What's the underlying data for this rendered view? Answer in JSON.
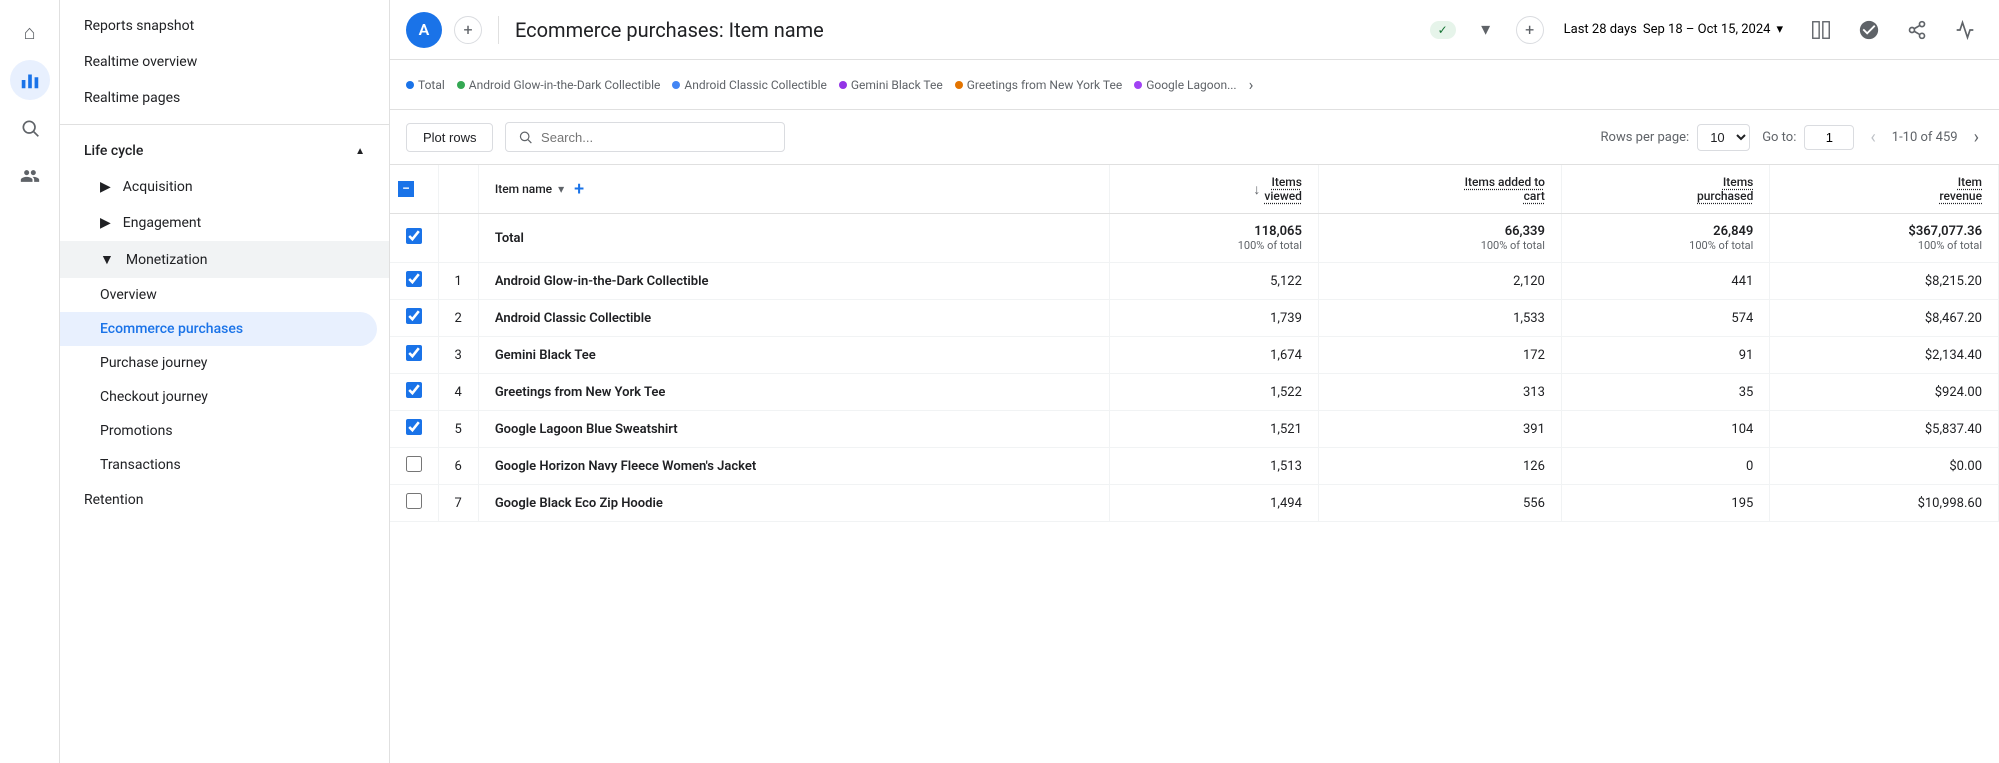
{
  "iconSidebar": {
    "items": [
      {
        "name": "home-icon",
        "icon": "⌂",
        "active": false
      },
      {
        "name": "analytics-icon",
        "icon": "📊",
        "active": true
      },
      {
        "name": "search-icon",
        "icon": "🔍",
        "active": false
      },
      {
        "name": "audience-icon",
        "icon": "👥",
        "active": false
      }
    ]
  },
  "navSidebar": {
    "topItems": [
      {
        "label": "Reports snapshot",
        "active": false
      },
      {
        "label": "Realtime overview",
        "active": false
      },
      {
        "label": "Realtime pages",
        "active": false
      }
    ],
    "sections": [
      {
        "label": "Life cycle",
        "expanded": true,
        "items": [
          {
            "label": "Acquisition",
            "expandable": true,
            "expanded": false,
            "sub": []
          },
          {
            "label": "Engagement",
            "expandable": true,
            "expanded": false,
            "sub": []
          },
          {
            "label": "Monetization",
            "expandable": true,
            "expanded": true,
            "sub": [
              {
                "label": "Overview",
                "active": false
              },
              {
                "label": "Ecommerce purchases",
                "active": true
              },
              {
                "label": "Purchase journey",
                "active": false
              },
              {
                "label": "Checkout journey",
                "active": false
              },
              {
                "label": "Promotions",
                "active": false
              },
              {
                "label": "Transactions",
                "active": false
              }
            ]
          },
          {
            "label": "Retention",
            "expandable": false,
            "expanded": false,
            "sub": []
          }
        ]
      }
    ]
  },
  "header": {
    "avatar": "A",
    "reportTitle": "Ecommerce purchases: Item name",
    "statusLabel": "✓",
    "dateRange": "Sep 18 – Oct 15, 2024",
    "dateLabel": "Last 28 days"
  },
  "chartLegend": {
    "items": [
      {
        "label": "Total",
        "color": "#1a73e8"
      },
      {
        "label": "Android Glow-in-the-Dark Collectible",
        "color": "#34a853"
      },
      {
        "label": "Android Classic Collectible",
        "color": "#4285f4"
      },
      {
        "label": "Gemini Black Tee",
        "color": "#9334e6"
      },
      {
        "label": "Greetings from New York Tee",
        "color": "#e37400"
      },
      {
        "label": "Google Lagoon...",
        "color": "#a142f4"
      }
    ]
  },
  "toolbar": {
    "plotRowsLabel": "Plot rows",
    "searchPlaceholder": "Search...",
    "rowsPerPageLabel": "Rows per page:",
    "rowsPerPageValue": "10",
    "gotoLabel": "Go to:",
    "gotoValue": "1",
    "pageInfo": "1-10 of 459"
  },
  "table": {
    "columns": [
      {
        "label": "",
        "key": "checkbox"
      },
      {
        "label": "",
        "key": "num"
      },
      {
        "label": "Item name",
        "key": "name",
        "hasDropdown": true,
        "hasAdd": true
      },
      {
        "label": "Items\nviewed",
        "key": "viewed",
        "underline": true,
        "hasSortArrow": true
      },
      {
        "label": "Items added to\ncart",
        "key": "cart",
        "underline": true
      },
      {
        "label": "Items\npurchased",
        "key": "purchased",
        "underline": true
      },
      {
        "label": "Item\nrevenue",
        "key": "revenue",
        "underline": true
      }
    ],
    "totalRow": {
      "label": "Total",
      "viewed": "118,065",
      "viewedSub": "100% of total",
      "cart": "66,339",
      "cartSub": "100% of total",
      "purchased": "26,849",
      "purchasedSub": "100% of total",
      "revenue": "$367,077.36",
      "revenueSub": "100% of total"
    },
    "rows": [
      {
        "num": 1,
        "name": "Android Glow-in-the-Dark Collectible",
        "viewed": "5,122",
        "cart": "2,120",
        "purchased": "441",
        "revenue": "$8,215.20",
        "checked": true
      },
      {
        "num": 2,
        "name": "Android Classic Collectible",
        "viewed": "1,739",
        "cart": "1,533",
        "purchased": "574",
        "revenue": "$8,467.20",
        "checked": true
      },
      {
        "num": 3,
        "name": "Gemini Black Tee",
        "viewed": "1,674",
        "cart": "172",
        "purchased": "91",
        "revenue": "$2,134.40",
        "checked": true
      },
      {
        "num": 4,
        "name": "Greetings from New York Tee",
        "viewed": "1,522",
        "cart": "313",
        "purchased": "35",
        "revenue": "$924.00",
        "checked": true
      },
      {
        "num": 5,
        "name": "Google Lagoon Blue Sweatshirt",
        "viewed": "1,521",
        "cart": "391",
        "purchased": "104",
        "revenue": "$5,837.40",
        "checked": true
      },
      {
        "num": 6,
        "name": "Google Horizon Navy Fleece Women's Jacket",
        "viewed": "1,513",
        "cart": "126",
        "purchased": "0",
        "revenue": "$0.00",
        "checked": false
      },
      {
        "num": 7,
        "name": "Google Black Eco Zip Hoodie",
        "viewed": "1,494",
        "cart": "556",
        "purchased": "195",
        "revenue": "$10,998.60",
        "checked": false
      }
    ]
  }
}
